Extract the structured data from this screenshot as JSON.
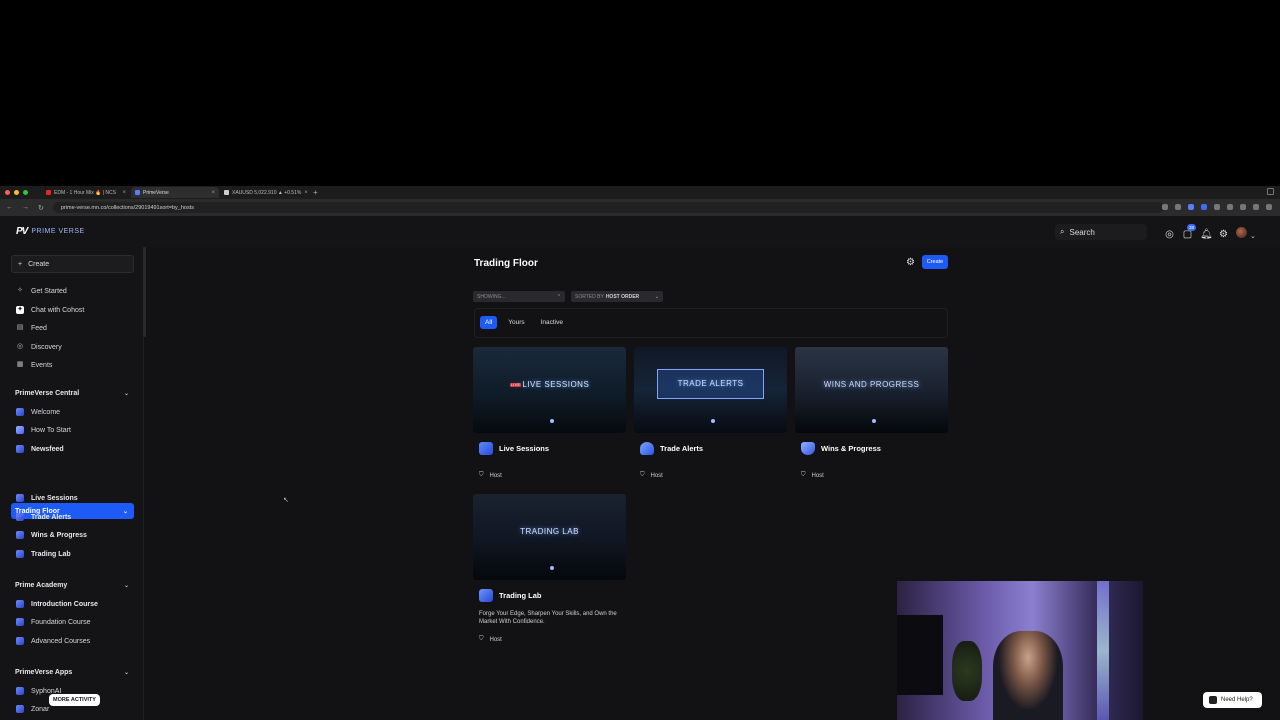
{
  "browser": {
    "tabs": [
      {
        "label": "EDM - 1 Hour Mix 🔥 | NCS",
        "active": false,
        "favicon_color": "#e22"
      },
      {
        "label": "PrimeVerse",
        "active": true,
        "favicon_color": "#5a7cff"
      },
      {
        "label": "XAUUSD 5,022.910 ▲ +0.51%",
        "active": false,
        "favicon_color": "#ccc"
      }
    ],
    "url": "prime-verse.mn.co/collections/29019491sort=by_hosts"
  },
  "topnav": {
    "logo_mark": "PV",
    "logo_text": "PRIME VERSE",
    "search_label": "Search",
    "notification_badge": "38"
  },
  "sidebar": {
    "create_label": "Create",
    "top_items": [
      {
        "label": "Get Started",
        "icon": "sparkle-icon"
      },
      {
        "label": "Chat with Cohost",
        "icon": "chat-icon"
      },
      {
        "label": "Feed",
        "icon": "feed-icon"
      },
      {
        "label": "Discovery",
        "icon": "compass-icon"
      },
      {
        "label": "Events",
        "icon": "calendar-icon"
      }
    ],
    "sections": [
      {
        "title": "PrimeVerse Central",
        "items": [
          "Welcome",
          "How To Start",
          "Newsfeed"
        ]
      },
      {
        "title": "Trading Floor",
        "items": [
          "Live Sessions",
          "Trade Alerts",
          "Wins & Progress",
          "Trading Lab"
        ]
      },
      {
        "title": "Prime Academy",
        "items": [
          "Introduction Course",
          "Foundation Course",
          "Advanced Courses"
        ]
      },
      {
        "title": "PrimeVerse Apps",
        "items": [
          "SyphonAI",
          "Zonar"
        ]
      }
    ],
    "more_activity": "MORE ACTIVITY"
  },
  "main": {
    "title": "Trading Floor",
    "create_button": "Create",
    "showing_label": "SHOWING...",
    "sorted_prefix": "SORTED BY",
    "sorted_value": "HOST ORDER",
    "filters": [
      "All",
      "Yours",
      "Inactive"
    ],
    "cards": [
      {
        "title": "Live Sessions",
        "thumb_label": "LIVE SESSIONS",
        "live_tag": "LIVE",
        "host": "Host",
        "description": ""
      },
      {
        "title": "Trade Alerts",
        "thumb_label": "TRADE ALERTS",
        "host": "Host",
        "description": ""
      },
      {
        "title": "Wins & Progress",
        "thumb_label": "WINS AND PROGRESS",
        "host": "Host",
        "description": ""
      },
      {
        "title": "Trading Lab",
        "thumb_label": "TRADING LAB",
        "host": "Host",
        "description": "Forge Your Edge, Sharpen Your Skills, and Own the Market With Confidence."
      }
    ]
  },
  "help_button": "Need Help?",
  "colors": {
    "accent": "#1e5bf6",
    "background": "#121214",
    "sidebar": "#141416"
  }
}
